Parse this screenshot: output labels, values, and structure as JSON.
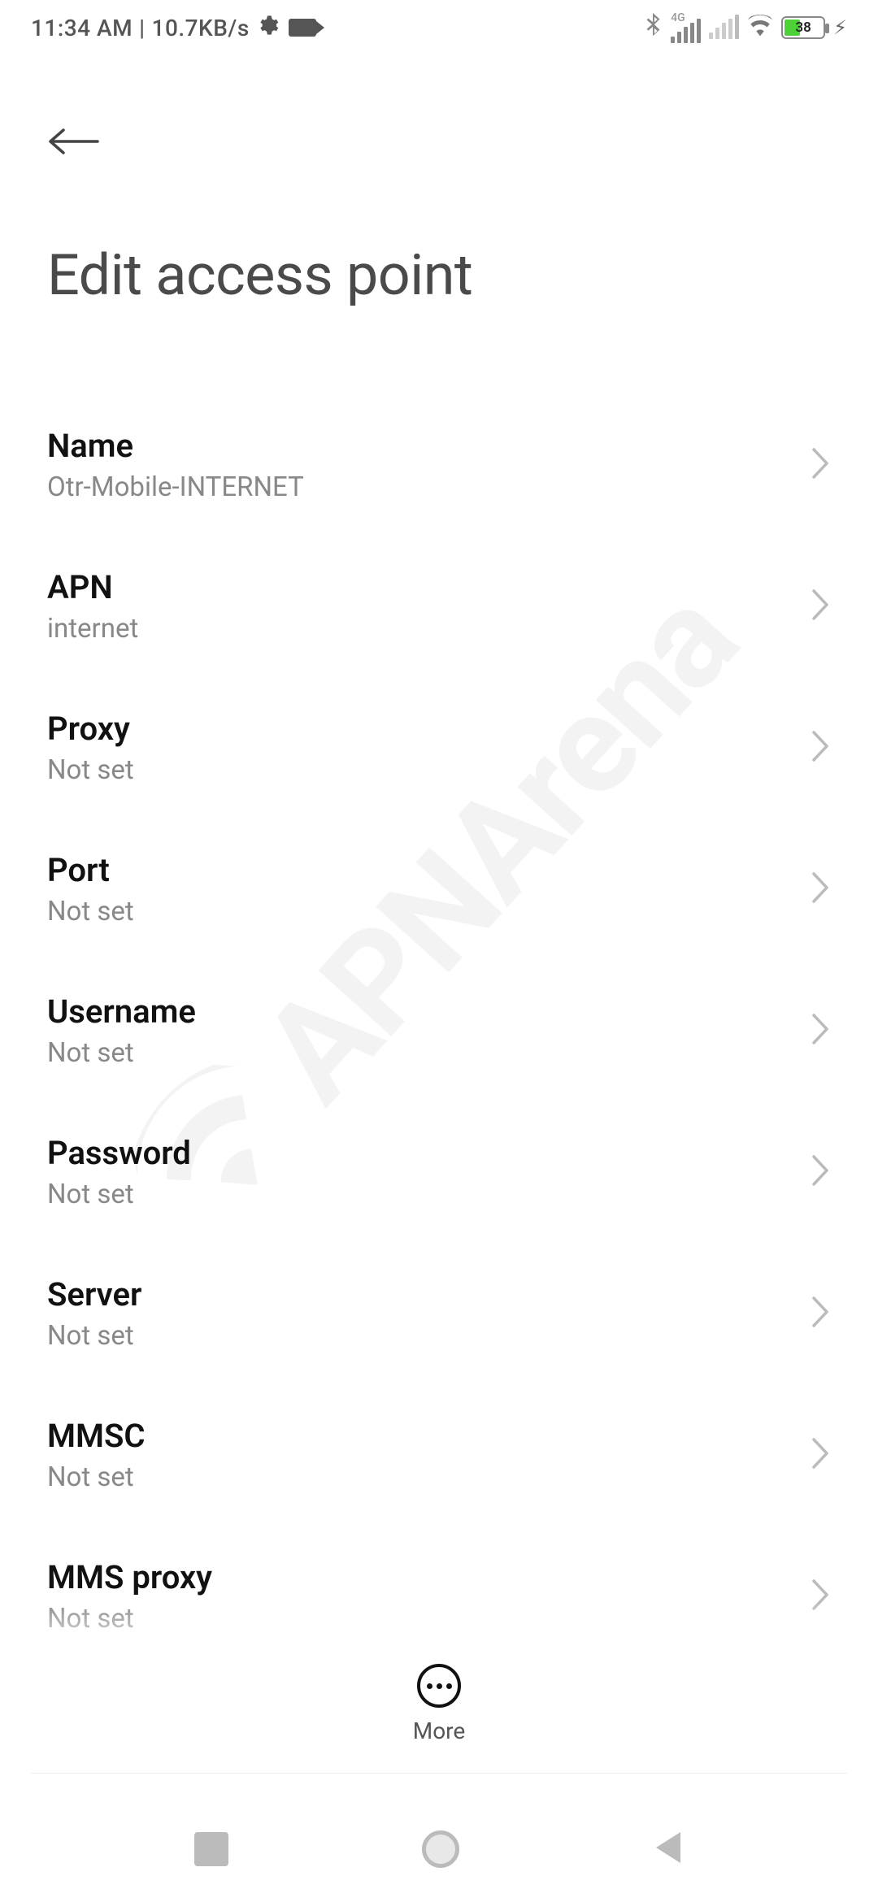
{
  "status_bar": {
    "time": "11:34 AM",
    "net_speed": "10.7KB/s",
    "battery_pct": "38",
    "net_label": "4G"
  },
  "header": {
    "title": "Edit access point"
  },
  "settings": [
    {
      "label": "Name",
      "value": "Otr-Mobile-INTERNET"
    },
    {
      "label": "APN",
      "value": "internet"
    },
    {
      "label": "Proxy",
      "value": "Not set"
    },
    {
      "label": "Port",
      "value": "Not set"
    },
    {
      "label": "Username",
      "value": "Not set"
    },
    {
      "label": "Password",
      "value": "Not set"
    },
    {
      "label": "Server",
      "value": "Not set"
    },
    {
      "label": "MMSC",
      "value": "Not set"
    },
    {
      "label": "MMS proxy",
      "value": "Not set"
    }
  ],
  "bottom": {
    "more_label": "More"
  },
  "watermark": {
    "text": "APNArena"
  }
}
